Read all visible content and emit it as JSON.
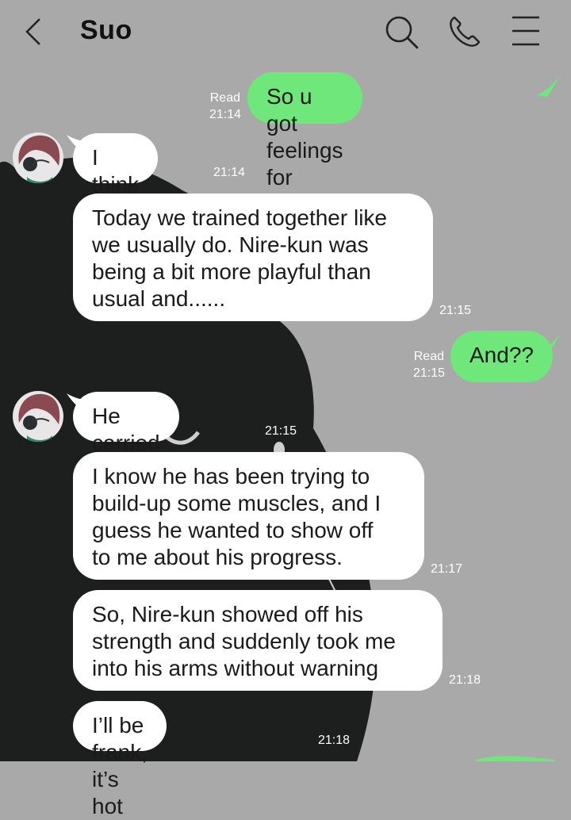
{
  "header": {
    "contact_name": "Suo",
    "back_icon": "chevron-left-icon",
    "search_icon": "search-icon",
    "call_icon": "phone-icon",
    "menu_icon": "hamburger-menu-icon"
  },
  "colors": {
    "background": "#a9a9a9",
    "incoming_bubble": "#ffffff",
    "outgoing_bubble": "#6fe77a"
  },
  "messages": [
    {
      "sender": "me",
      "text": "So u got feelings for him?",
      "read": "Read",
      "time": "21:14"
    },
    {
      "sender": "Suo",
      "text": "I think so",
      "time": "21:14"
    },
    {
      "sender": "Suo",
      "text": "Today we trained together like\nwe usually do. Nire-kun was\nbeing a bit more playful than\nusual and......",
      "time": "21:15"
    },
    {
      "sender": "me",
      "text": "And??",
      "read": "Read",
      "time": "21:15"
    },
    {
      "sender": "Suo",
      "text": "He carried me",
      "time": "21:15"
    },
    {
      "sender": "Suo",
      "text": "I know he has been trying to\nbuild-up some muscles, and I\nguess he wanted to show off\nto me about his progress.",
      "time": "21:17"
    },
    {
      "sender": "Suo",
      "text": "So, Nire-kun showed off his\nstrength and suddenly took me\ninto his arms without warning",
      "time": "21:18"
    },
    {
      "sender": "Suo",
      "text": "I’ll be frank, it’s hot",
      "time": "21:18"
    }
  ]
}
